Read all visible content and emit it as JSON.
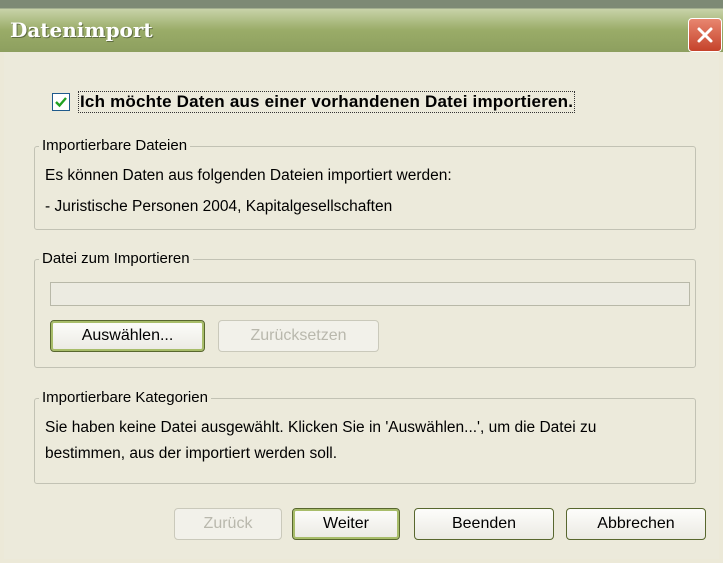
{
  "window": {
    "title": "Datenimport"
  },
  "import_checkbox": {
    "checked": true,
    "label": "Ich möchte Daten aus einer vorhandenen Datei importieren."
  },
  "importable_files": {
    "legend": "Importierbare Dateien",
    "line1": "Es können Daten aus folgenden Dateien importiert werden:",
    "line2": "- Juristische Personen 2004, Kapitalgesellschaften"
  },
  "file_to_import": {
    "legend": "Datei zum Importieren",
    "value": "",
    "select_label": "Auswählen...",
    "reset_label": "Zurücksetzen"
  },
  "importable_categories": {
    "legend": "Importierbare Kategorien",
    "line1": "Sie haben keine Datei ausgewählt. Klicken Sie in 'Auswählen...', um die Datei zu",
    "line2": "bestimmen, aus der importiert werden soll."
  },
  "footer": {
    "back_label": "Zurück",
    "next_label": "Weiter",
    "finish_label": "Beenden",
    "cancel_label": "Abbrechen"
  },
  "icons": {
    "close": "close-icon",
    "check": "checkmark-icon"
  },
  "colors": {
    "titlebar": "#9aac68",
    "dialog_bg": "#eceadb",
    "close_button": "#d45a40",
    "button_border": "#58672e"
  }
}
